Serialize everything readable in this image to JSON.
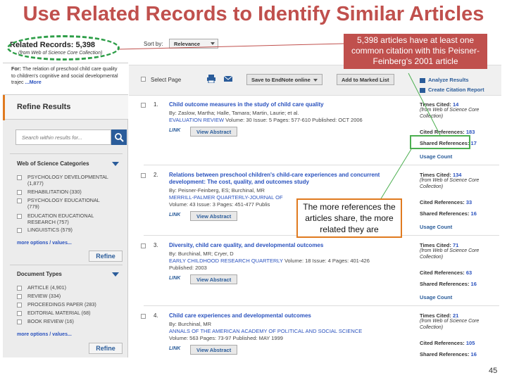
{
  "slide": {
    "title": "Use Related Records to Identify Similar Articles",
    "page_number": "45"
  },
  "sidebar": {
    "related_title": "Related Records: 5,398",
    "related_sub": "(from Web of Science Core Collection)",
    "for_label": "For:",
    "for_text": "The relation of preschool child care quality to children's cognitive and social developmental trajec",
    "for_more": "...More",
    "refine_results": "Refine Results",
    "search_placeholder": "Search within results for...",
    "categories_title": "Web of Science Categories",
    "categories": [
      "PSYCHOLOGY DEVELOPMENTAL (1,877)",
      "REHABILITATION (330)",
      "PSYCHOLOGY EDUCATIONAL (779)",
      "EDUCATION EDUCATIONAL RESEARCH (757)",
      "LINGUISTICS (579)"
    ],
    "more_options": "more options / values...",
    "refine_button": "Refine",
    "doctypes_title": "Document Types",
    "doctypes": [
      "ARTICLE (4,901)",
      "REVIEW (334)",
      "PROCEEDINGS PAPER (283)",
      "EDITORIAL MATERIAL (68)",
      "BOOK REVIEW (16)"
    ]
  },
  "toolbar": {
    "sort_by": "Sort by:",
    "sort_value": "Relevance",
    "select_page": "Select Page",
    "save_endnote": "Save to EndNote online",
    "add_marked": "Add to Marked List",
    "analyze": "Analyze Results",
    "citation_report": "Create Citation Report"
  },
  "records": [
    {
      "num": "1.",
      "title": "Child outcome measures in the study of child care quality",
      "authors": "By: Zaslow, Martha; Halle, Tamara; Martin, Laurie; et al.",
      "journal": "EVALUATION REVIEW",
      "details": " Volume: 30  Issue: 5  Pages: 577-610  Published: OCT 2006",
      "published": "",
      "times_cited": "14",
      "times_cited_label": "Times Cited:",
      "coll_note": "(from Web of Science Core Collection)",
      "cited_refs_label": "Cited References:",
      "cited_refs": "183",
      "shared_refs_label": "Shared References:",
      "shared_refs": "17",
      "usage": "Usage Count"
    },
    {
      "num": "2.",
      "title": "Relations between preschool children's child-care experiences and concurrent development: The cost, quality, and outcomes study",
      "authors": "By: Peisner-Feinberg, ES; Burchinal, MR",
      "journal": "MERRILL-PALMER QUARTERLY-JOURNAL OF",
      "details": " Volume: 43  Issue: 3  Pages: 451-477  Publis",
      "published": "",
      "times_cited": "134",
      "times_cited_label": "Times Cited:",
      "coll_note": "(from Web of Science Core Collection)",
      "cited_refs_label": "Cited References:",
      "cited_refs": "33",
      "shared_refs_label": "Shared References:",
      "shared_refs": "16",
      "usage": "Usage Count"
    },
    {
      "num": "3.",
      "title": "Diversity, child care quality, and developmental outcomes",
      "authors": "By: Burchinal, MR; Cryer, D",
      "journal": "EARLY CHILDHOOD RESEARCH QUARTERLY",
      "details": "  Volume: 18  Issue: 4  Pages: 401-426",
      "published": "Published: 2003",
      "times_cited": "71",
      "times_cited_label": "Times Cited:",
      "coll_note": "(from Web of Science Core Collection)",
      "cited_refs_label": "Cited References:",
      "cited_refs": "63",
      "shared_refs_label": "Shared References:",
      "shared_refs": "16",
      "usage": "Usage Count"
    },
    {
      "num": "4.",
      "title": "Child care experiences and developmental outcomes",
      "authors": "By: Burchinal, MR",
      "journal": "ANNALS OF THE AMERICAN ACADEMY OF POLITICAL AND SOCIAL SCIENCE",
      "details": "Volume: 563  Pages: 73-97  Published: MAY 1999",
      "published": "",
      "times_cited": "21",
      "times_cited_label": "Times Cited:",
      "coll_note": "(from Web of Science Core Collection)",
      "cited_refs_label": "Cited References:",
      "cited_refs": "105",
      "shared_refs_label": "Shared References:",
      "shared_refs": "16",
      "usage": ""
    }
  ],
  "link_label": "LINK",
  "view_abstract": "View Abstract",
  "annotations": {
    "red_box": "5,398 articles have at least one common citation with this Peisner-Feinberg's 2001 article",
    "white_box": "The more references the articles share, the more related they are"
  },
  "colors": {
    "title_red": "#c0504d",
    "annotation_red": "#c0504d",
    "highlight_green": "#2e9e48",
    "accent_orange": "#e07a1f",
    "link_blue": "#2a52be"
  }
}
